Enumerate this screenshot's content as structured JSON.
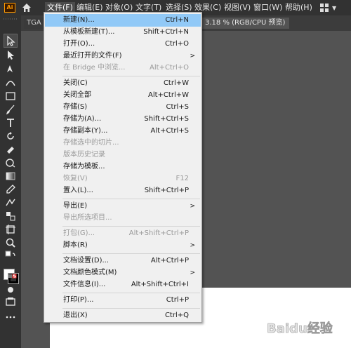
{
  "app": {
    "logo_text": "Ai",
    "accent": "#ff9a00"
  },
  "menubar": {
    "items": [
      "文件(F)",
      "编辑(E)",
      "对象(O)",
      "文字(T)",
      "选择(S)",
      "效果(C)",
      "视图(V)",
      "窗口(W)",
      "帮助(H)"
    ],
    "active_index": 0
  },
  "tabs": {
    "doc1": "TGA",
    "doc2": "3.18 % (RGB/CPU 预览)"
  },
  "file_menu": {
    "items": [
      {
        "label": "新建(N)...",
        "shortcut": "Ctrl+N",
        "highlight": true
      },
      {
        "label": "从模板新建(T)...",
        "shortcut": "Shift+Ctrl+N"
      },
      {
        "label": "打开(O)...",
        "shortcut": "Ctrl+O"
      },
      {
        "label": "最近打开的文件(F)",
        "shortcut": "",
        "submenu": true
      },
      {
        "label": "在 Bridge 中浏览...",
        "shortcut": "Alt+Ctrl+O",
        "disabled": true
      },
      {
        "label": "关闭(C)",
        "shortcut": "Ctrl+W"
      },
      {
        "label": "关闭全部",
        "shortcut": "Alt+Ctrl+W"
      },
      {
        "label": "存储(S)",
        "shortcut": "Ctrl+S"
      },
      {
        "label": "存储为(A)...",
        "shortcut": "Shift+Ctrl+S"
      },
      {
        "label": "存储副本(Y)...",
        "shortcut": "Alt+Ctrl+S"
      },
      {
        "label": "存储选中的切片...",
        "shortcut": "",
        "disabled": true
      },
      {
        "label": "版本历史记录",
        "shortcut": "",
        "disabled": true
      },
      {
        "label": "存储为模板...",
        "shortcut": ""
      },
      {
        "label": "恢复(V)",
        "shortcut": "F12",
        "disabled": true
      },
      {
        "label": "置入(L)...",
        "shortcut": "Shift+Ctrl+P"
      },
      {
        "label": "导出(E)",
        "shortcut": "",
        "submenu": true
      },
      {
        "label": "导出所选项目...",
        "shortcut": "",
        "disabled": true
      },
      {
        "label": "打包(G)...",
        "shortcut": "Alt+Shift+Ctrl+P",
        "disabled": true
      },
      {
        "label": "脚本(R)",
        "shortcut": "",
        "submenu": true
      },
      {
        "label": "文档设置(D)...",
        "shortcut": "Alt+Ctrl+P"
      },
      {
        "label": "文档颜色模式(M)",
        "shortcut": "",
        "submenu": true
      },
      {
        "label": "文件信息(I)...",
        "shortcut": "Alt+Shift+Ctrl+I"
      },
      {
        "label": "打印(P)...",
        "shortcut": "Ctrl+P"
      },
      {
        "label": "退出(X)",
        "shortcut": "Ctrl+Q"
      }
    ]
  },
  "watermark": {
    "text": "Baidu经验"
  }
}
